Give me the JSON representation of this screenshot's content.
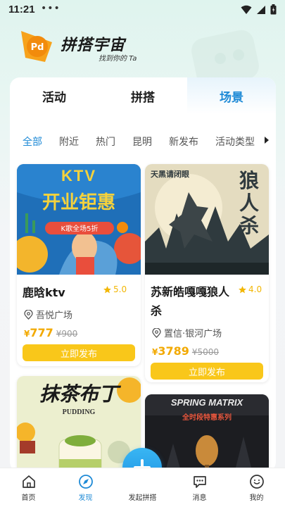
{
  "status_bar": {
    "time": "11:21",
    "dots": "•••"
  },
  "header": {
    "app_title": "拼搭宇宙",
    "slogan": "找到你的 Ta"
  },
  "top_tabs": [
    {
      "label": "活动",
      "active": false
    },
    {
      "label": "拼搭",
      "active": false
    },
    {
      "label": "场景",
      "active": true
    }
  ],
  "filters": [
    {
      "label": "全部",
      "active": true
    },
    {
      "label": "附近",
      "active": false
    },
    {
      "label": "热门",
      "active": false
    },
    {
      "label": "昆明",
      "active": false
    },
    {
      "label": "新发布",
      "active": false
    },
    {
      "label": "活动类型",
      "active": false
    }
  ],
  "cards": [
    {
      "title": "鹿晗ktv",
      "rating": "5.0",
      "location": "吾悦广场",
      "currency": "¥",
      "price": "777",
      "old_price": "¥900",
      "button": "立即发布",
      "poster": {
        "line1": "KTV",
        "line2": "开业钜惠",
        "line3": "K歌全场5折"
      }
    },
    {
      "title": "苏新皓嘎嘎狼人杀",
      "rating": "4.0",
      "location": "置信·银河广场",
      "currency": "¥",
      "price": "3789",
      "old_price": "¥5000",
      "button": "立即发布",
      "poster": {
        "line1": "狼",
        "line2": "人",
        "line3": "杀",
        "tag": "天黑请闭眼"
      }
    },
    {
      "poster": {
        "line1": "抹茶布丁",
        "line2": "PUDDING"
      }
    },
    {
      "poster": {
        "line1": "SPRING MATRIX",
        "line2": "全时段特惠系列"
      }
    }
  ],
  "bottom_nav": [
    {
      "label": "首页",
      "icon": "home-icon",
      "active": false
    },
    {
      "label": "发现",
      "icon": "discover-icon",
      "active": true
    },
    {
      "label": "发起拼搭",
      "icon": "plus-icon",
      "active": false
    },
    {
      "label": "消息",
      "icon": "message-icon",
      "active": false
    },
    {
      "label": "我的",
      "icon": "profile-icon",
      "active": false
    }
  ],
  "colors": {
    "accent": "#1e8ad6",
    "price": "#f2a900",
    "button": "#f9c71a",
    "star": "#f2b705"
  }
}
